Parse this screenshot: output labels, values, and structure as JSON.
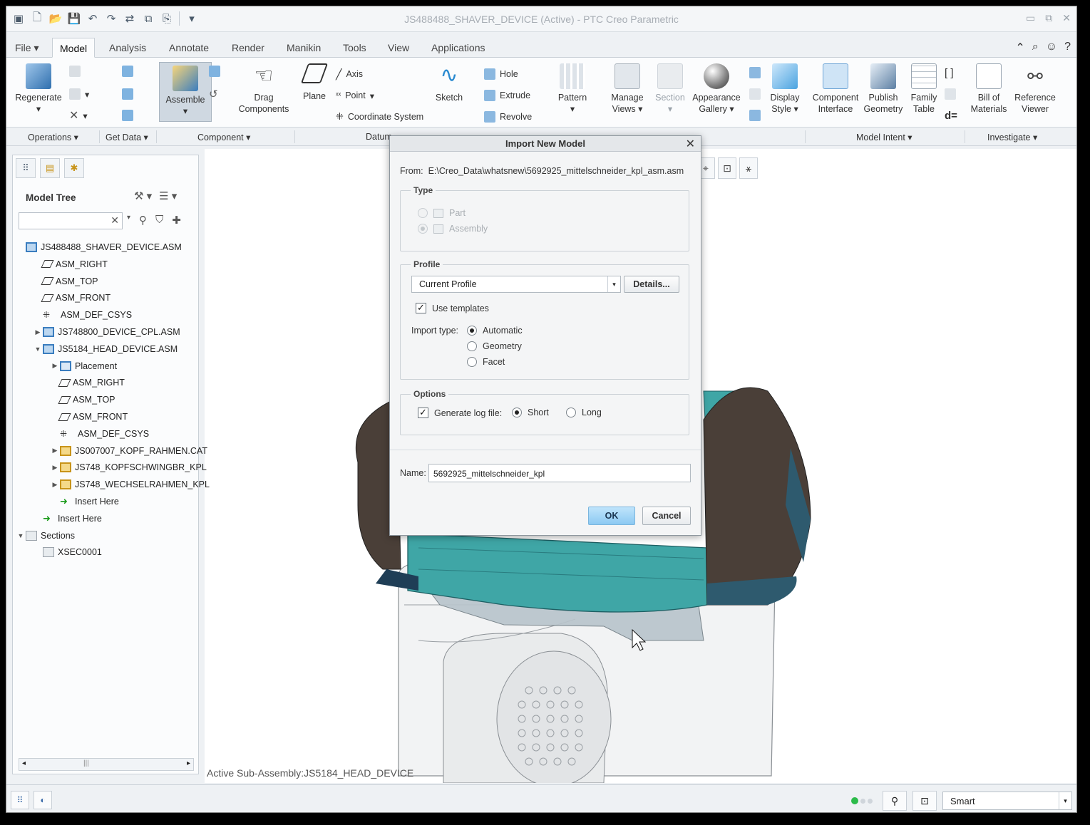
{
  "window": {
    "title": "JS488488_SHAVER_DEVICE (Active) - PTC Creo Parametric"
  },
  "tabs": [
    {
      "label": "File",
      "has_dropdown": true
    },
    {
      "label": "Model",
      "active": true
    },
    {
      "label": "Analysis"
    },
    {
      "label": "Annotate"
    },
    {
      "label": "Render"
    },
    {
      "label": "Manikin"
    },
    {
      "label": "Tools"
    },
    {
      "label": "View"
    },
    {
      "label": "Applications"
    }
  ],
  "ribbon": {
    "regenerate": "Regenerate",
    "assemble": "Assemble",
    "drag_components": "Drag Components",
    "drag_line1": "Drag",
    "drag_line2": "Components",
    "plane": "Plane",
    "axis": "Axis",
    "point": "Point",
    "coordinate_system": "Coordinate System",
    "sketch": "Sketch",
    "hole": "Hole",
    "extrude": "Extrude",
    "revolve": "Revolve",
    "pattern": "Pattern",
    "manage_views_1": "Manage",
    "manage_views_2": "Views",
    "section": "Section",
    "appearance_1": "Appearance",
    "appearance_2": "Gallery",
    "display_style_1": "Display",
    "display_style_2": "Style",
    "component_interface_1": "Component",
    "component_interface_2": "Interface",
    "publish_geometry_1": "Publish",
    "publish_geometry_2": "Geometry",
    "family_table_1": "Family",
    "family_table_2": "Table",
    "bill_of_materials_1": "Bill of",
    "bill_of_materials_2": "Materials",
    "reference_viewer_1": "Reference",
    "reference_viewer_2": "Viewer"
  },
  "groups": {
    "operations": "Operations",
    "get_data": "Get Data",
    "component": "Component",
    "datum": "Datum",
    "model_intent": "Model Intent",
    "investigate": "Investigate"
  },
  "model_tree": {
    "title": "Model Tree",
    "search_placeholder": "",
    "nodes": [
      {
        "label": "JS488488_SHAVER_DEVICE.ASM",
        "icon": "assembly-icon",
        "indent": 0,
        "twisty": ""
      },
      {
        "label": "ASM_RIGHT",
        "icon": "datum-plane-icon",
        "indent": 1,
        "twisty": ""
      },
      {
        "label": "ASM_TOP",
        "icon": "datum-plane-icon",
        "indent": 1,
        "twisty": ""
      },
      {
        "label": "ASM_FRONT",
        "icon": "datum-plane-icon",
        "indent": 1,
        "twisty": ""
      },
      {
        "label": "ASM_DEF_CSYS",
        "icon": "csys-icon",
        "indent": 1,
        "twisty": ""
      },
      {
        "label": "JS748800_DEVICE_CPL.ASM",
        "icon": "assembly-icon",
        "indent": 1,
        "twisty": "collapsed"
      },
      {
        "label": "JS5184_HEAD_DEVICE.ASM",
        "icon": "assembly-icon",
        "indent": 1,
        "twisty": "expanded"
      },
      {
        "label": "Placement",
        "icon": "placement-icon",
        "indent": 2,
        "twisty": "collapsed"
      },
      {
        "label": "ASM_RIGHT",
        "icon": "datum-plane-icon",
        "indent": 2,
        "twisty": ""
      },
      {
        "label": "ASM_TOP",
        "icon": "datum-plane-icon",
        "indent": 2,
        "twisty": ""
      },
      {
        "label": "ASM_FRONT",
        "icon": "datum-plane-icon",
        "indent": 2,
        "twisty": ""
      },
      {
        "label": "ASM_DEF_CSYS",
        "icon": "csys-icon",
        "indent": 2,
        "twisty": ""
      },
      {
        "label": "JS007007_KOPF_RAHMEN.CAT",
        "icon": "part-icon",
        "indent": 2,
        "twisty": "collapsed"
      },
      {
        "label": "JS748_KOPFSCHWINGBR_KPL",
        "icon": "part-icon",
        "indent": 2,
        "twisty": "collapsed"
      },
      {
        "label": "JS748_WECHSELRAHMEN_KPL",
        "icon": "part-icon",
        "indent": 2,
        "twisty": "collapsed"
      },
      {
        "label": "Insert Here",
        "icon": "insert-arrow-icon",
        "indent": 2,
        "twisty": ""
      },
      {
        "label": "Insert Here",
        "icon": "insert-arrow-icon",
        "indent": 1,
        "twisty": ""
      },
      {
        "label": "Sections",
        "icon": "sections-icon",
        "indent": 0,
        "twisty": "expanded"
      },
      {
        "label": "XSEC0001",
        "icon": "section-icon",
        "indent": 1,
        "twisty": ""
      }
    ]
  },
  "viewport": {
    "active_subassembly": "Active Sub-Assembly:JS5184_HEAD_DEVICE"
  },
  "status": {
    "filter": "Smart"
  },
  "dialog": {
    "title": "Import New Model",
    "from_label": "From:",
    "from_path": "E:\\Creo_Data\\whatsnew\\5692925_mittelschneider_kpl_asm.asm",
    "type": {
      "legend": "Type",
      "part": "Part",
      "assembly": "Assembly"
    },
    "profile": {
      "legend": "Profile",
      "current": "Current Profile",
      "details": "Details...",
      "use_templates": "Use templates",
      "import_type_label": "Import type:",
      "automatic": "Automatic",
      "geometry": "Geometry",
      "facet": "Facet"
    },
    "options": {
      "legend": "Options",
      "generate_log": "Generate log file:",
      "short": "Short",
      "long": "Long"
    },
    "name_label": "Name:",
    "name_value": "5692925_mittelschneider_kpl",
    "ok": "OK",
    "cancel": "Cancel"
  },
  "colors": {
    "accent": "#3a7dbf",
    "teal_part": "#3fa6a6",
    "dark_shell": "#4a3f38",
    "ok_button": "#8cc9f2"
  }
}
